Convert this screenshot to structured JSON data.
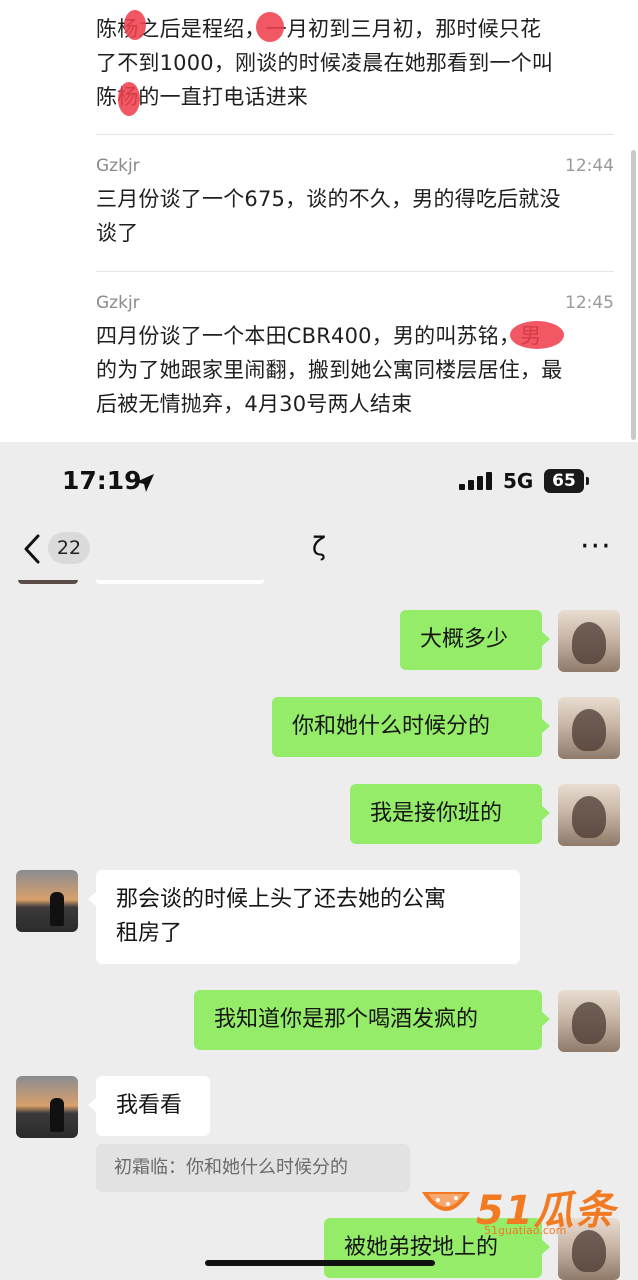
{
  "history": {
    "entries": [
      {
        "sender": "",
        "time": "",
        "lines": [
          "陈杨之后是程绍",
          "了不到1000，刚谈的时候凌晨在她那看到一个叫",
          "陈杨的一直打电话进来"
        ],
        "line1_tail": "，一月初到三月初，那时候只花"
      },
      {
        "sender": "Gzkjr",
        "time": "12:44",
        "lines": [
          "三月份谈了一个675，谈的不久，男的得吃后就没",
          "谈了"
        ]
      },
      {
        "sender": "Gzkjr",
        "time": "12:45",
        "lines": [
          "四月份谈了一个本田CBR400，男的叫苏铭，男",
          "的为了她跟家里闹翻，搬到她公寓同楼层居住，最",
          "后被无情抛弃，4月30号两人结束"
        ]
      }
    ]
  },
  "status_bar": {
    "time": "17:19",
    "network": "5G",
    "battery": "65"
  },
  "nav": {
    "unread_count": "22",
    "title": "ζ",
    "more": "···"
  },
  "messages": [
    {
      "from": "me",
      "text": "大概多少"
    },
    {
      "from": "me",
      "text": "你和她什么时候分的"
    },
    {
      "from": "me",
      "text": "我是接你班的"
    },
    {
      "from": "other",
      "lines": [
        "那会谈的时候上头了还去她的公寓",
        "租房了"
      ]
    },
    {
      "from": "me",
      "text": "我知道你是那个喝酒发疯的"
    },
    {
      "from": "other",
      "text": "我看看"
    },
    {
      "from": "me",
      "text": "被她弟按地上的"
    }
  ],
  "quote": {
    "text": "初霜临：你和她什么时候分的"
  },
  "watermark": {
    "brand": "51瓜条",
    "url": "51guatiao.com"
  },
  "colors": {
    "bubble_me": "#95ec69",
    "bubble_other": "#ffffff",
    "chat_bg": "#ededed",
    "watermark": "#f27a22"
  }
}
